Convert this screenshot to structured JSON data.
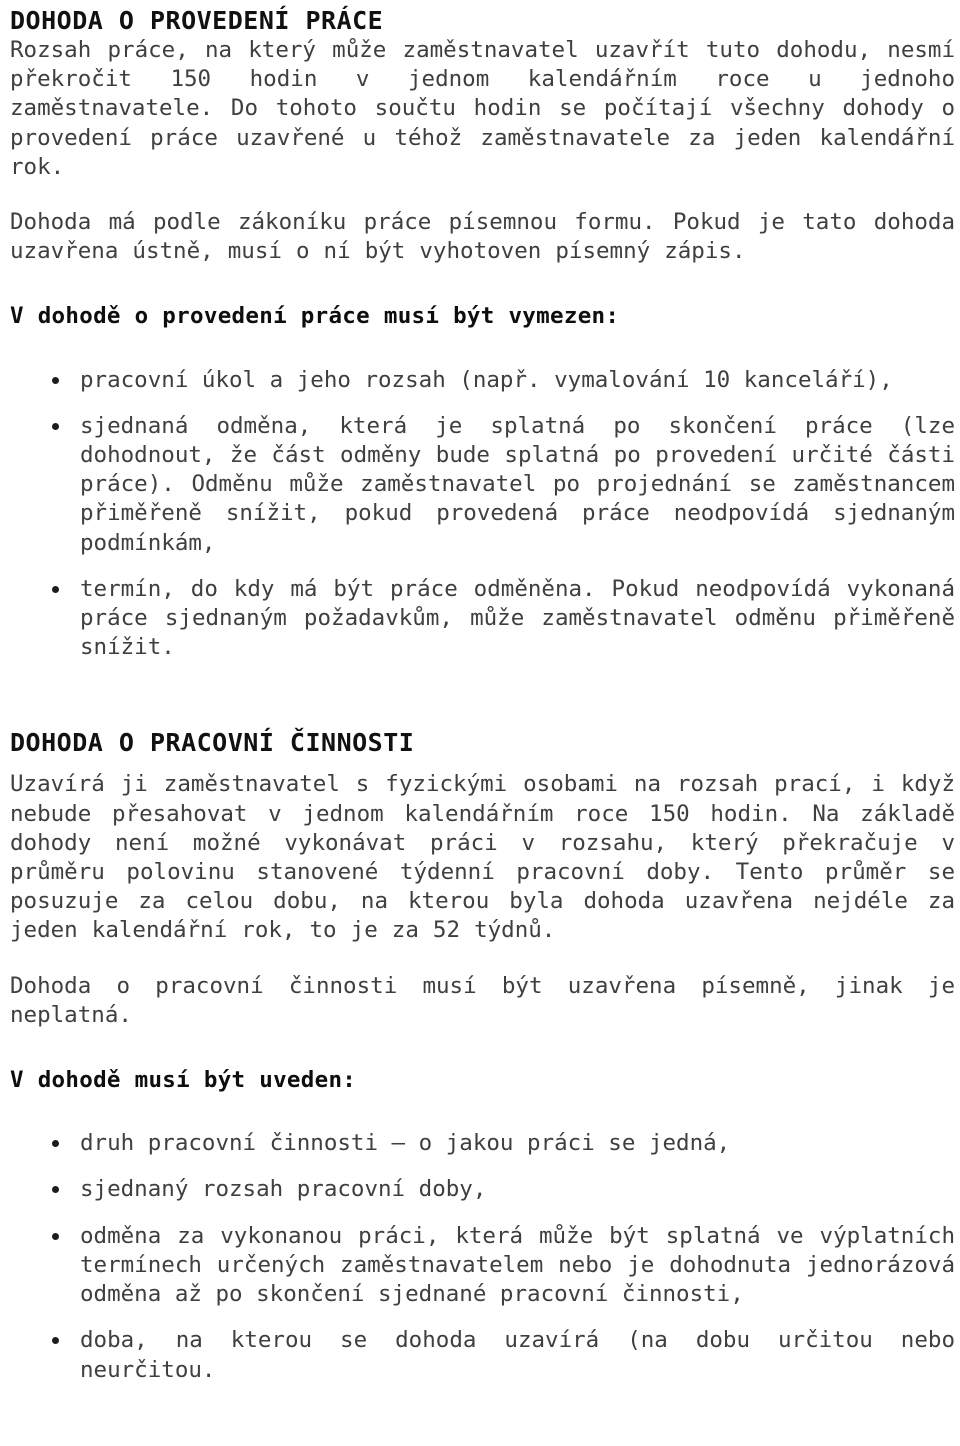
{
  "document": {
    "language": "cs",
    "text_color": "#3f3f3f",
    "heading_color": "#111111",
    "background_color": "#ffffff",
    "sections": [
      {
        "id": "dohoda-o-provedeni-prace",
        "heading": "DOHODA O PROVEDENÍ PRÁCE",
        "paragraphs": [
          "Rozsah práce, na který může zaměstnavatel uzavřít tuto dohodu, nesmí překročit 150 hodin v jednom kalendářním roce u jednoho zaměstnavatele. Do tohoto součtu hodin se počítají všechny dohody o provedení práce uzavřené u téhož zaměstnavatele za jeden kalendářní rok.",
          "Dohoda má podle zákoníku práce písemnou formu. Pokud je tato dohoda uzavřena ústně, musí o ní být vyhotoven písemný zápis."
        ],
        "list_heading": "V dohodě o provedení práce musí být vymezen:",
        "list_items": [
          "pracovní úkol a jeho rozsah (např. vymalování 10 kanceláří),",
          "sjednaná odměna, která je splatná po skončení práce (lze dohodnout, že část odměny bude splatná po provedení určité části práce). Odměnu může zaměstnavatel po projednání se zaměstnancem přiměřeně snížit, pokud provedená práce neodpovídá sjednaným podmínkám,",
          "termín, do kdy má být práce odměněna. Pokud neodpovídá vykonaná práce sjednaným požadavkům, může zaměstnavatel odměnu přiměřeně snížit."
        ]
      },
      {
        "id": "dohoda-o-pracovni-cinnosti",
        "heading": "DOHODA O PRACOVNÍ ČINNOSTI",
        "paragraphs": [
          "Uzavírá ji zaměstnavatel s fyzickými osobami na rozsah prací, i když nebude přesahovat v jednom kalendářním roce 150 hodin. Na základě dohody není možné vykonávat práci v rozsahu, který překračuje v průměru polovinu stanovené týdenní pracovní doby. Tento průměr se posuzuje za celou dobu, na kterou byla dohoda uzavřena nejdéle za jeden kalendářní rok, to je za 52 týdnů.",
          "Dohoda o pracovní činnosti musí být uzavřena písemně, jinak je neplatná."
        ],
        "list_heading": "V dohodě musí být uveden:",
        "list_items": [
          "druh pracovní činnosti – o jakou práci se jedná,",
          "sjednaný rozsah pracovní doby,",
          "odměna za vykonanou práci, která může být splatná ve výplatních termínech určených zaměstnavatelem nebo je dohodnuta jednorázová odměna až po skončení sjednané pracovní činnosti,",
          "doba, na kterou se dohoda uzavírá (na dobu určitou nebo neurčitou."
        ]
      }
    ]
  }
}
